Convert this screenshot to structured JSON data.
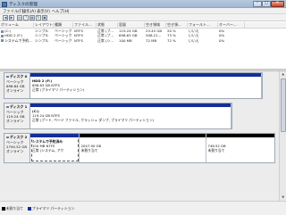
{
  "window": {
    "title": "ディスクの管理",
    "minimize": "–",
    "maximize": "□",
    "close": "✕"
  },
  "menu": [
    "ファイル(F)",
    "操作(A)",
    "表示(V)",
    "ヘルプ(H)"
  ],
  "toolbar_icons": [
    "back-arrow-icon",
    "forward-arrow-icon",
    "console-icon",
    "help-icon",
    "properties-icon",
    "refresh-icon",
    "console-tree-icon"
  ],
  "volume_table": {
    "columns": [
      "ボリューム",
      "レイアウト",
      "種類",
      "ファイル...",
      "状態",
      "容量",
      "空き領域",
      "空き領...",
      "フォールト...",
      "オーバー..."
    ],
    "rows": [
      [
        "(C:)",
        "シンプル",
        "ベーシック",
        "NTFS",
        "正常 (ブ...",
        "119.24 GB",
        "23.45 GB",
        "20 %",
        "いいえ",
        "0%"
      ],
      [
        "HDD 2 (F:)",
        "シンプル",
        "ベーシック",
        "NTFS",
        "正常 (プ...",
        "698.63 GB",
        "508.21...",
        "73 %",
        "いいえ",
        "0%"
      ],
      [
        "システムで予約...",
        "シンプル",
        "ベーシック",
        "NTFS",
        "正常 (シ...",
        "100 MB",
        "72 MB",
        "72 %",
        "いいえ",
        "0%"
      ]
    ]
  },
  "disks": [
    {
      "name": "ディスク 0",
      "type": "ベーシック",
      "size": "698.64 GB",
      "status": "オンライン",
      "partitions": [
        {
          "title": "HDD 2 (F:)",
          "size": "698.63 GB NTFS",
          "status": "正常 (プライマリ パーティション)",
          "bar": "blue",
          "share": 1.0
        }
      ]
    },
    {
      "name": "ディスク 1",
      "type": "ベーシック",
      "size": "119.24 GB",
      "status": "オンライン",
      "partitions": [
        {
          "title": "(C:)",
          "size": "119.24 GB NTFS",
          "status": "正常 (ブート, ページ ファイル, クラッシュ ダンプ, プライマリ パーティション)",
          "bar": "blue",
          "share": 1.0
        }
      ]
    },
    {
      "name": "ディスク 2",
      "type": "ベーシック",
      "size": "2794.52 GB",
      "status": "オンライン",
      "partitions": [
        {
          "title": "システムで予約済み",
          "size": "100 MB NTFS",
          "status": "正常 (システム, アク",
          "bar": "blue",
          "share": 0.2
        },
        {
          "title": "",
          "size": "2047.90 GB",
          "status": "未割り当て",
          "bar": "black",
          "share": 0.52
        },
        {
          "title": "",
          "size": "746.52 GB",
          "status": "未割り当て",
          "bar": "black",
          "share": 0.28
        }
      ]
    }
  ],
  "legend": [
    {
      "label": "未割り当て",
      "color": "#000000"
    },
    {
      "label": "プライマリ パーティション",
      "color": "#152d9a"
    }
  ]
}
